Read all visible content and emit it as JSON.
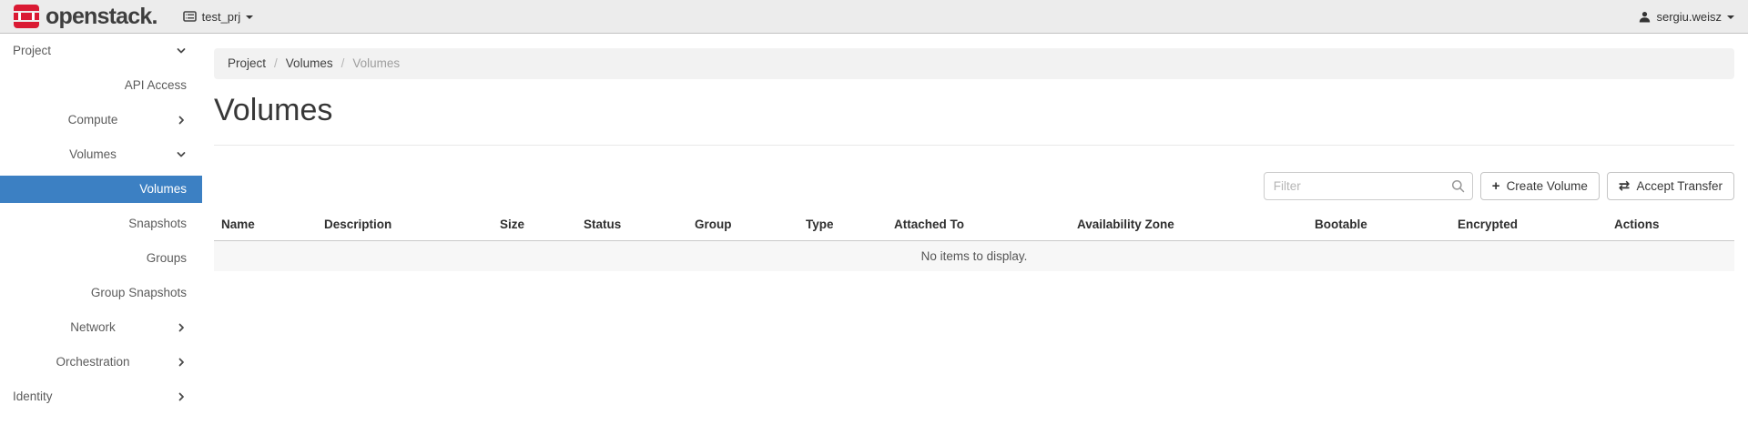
{
  "navbar": {
    "brand": "openstack.",
    "project_switcher": "test_prj",
    "user": "sergiu.weisz"
  },
  "sidebar": {
    "items": [
      {
        "label": "Project",
        "level": 1,
        "state": "expanded"
      },
      {
        "label": "API Access",
        "level": 3,
        "state": "link"
      },
      {
        "label": "Compute",
        "level": 2,
        "state": "collapsed"
      },
      {
        "label": "Volumes",
        "level": 2,
        "state": "expanded"
      },
      {
        "label": "Volumes",
        "level": 3,
        "state": "active"
      },
      {
        "label": "Snapshots",
        "level": 3,
        "state": "link"
      },
      {
        "label": "Groups",
        "level": 3,
        "state": "link"
      },
      {
        "label": "Group Snapshots",
        "level": 3,
        "state": "link"
      },
      {
        "label": "Network",
        "level": 2,
        "state": "collapsed"
      },
      {
        "label": "Orchestration",
        "level": 2,
        "state": "collapsed"
      },
      {
        "label": "Identity",
        "level": 1,
        "state": "collapsed"
      }
    ]
  },
  "breadcrumb": {
    "separator": "/",
    "items": [
      "Project",
      "Volumes",
      "Volumes"
    ]
  },
  "page": {
    "title": "Volumes"
  },
  "toolbar": {
    "filter_placeholder": "Filter",
    "create_volume_label": "Create Volume",
    "accept_transfer_label": "Accept Transfer"
  },
  "icons": {
    "plus": "+",
    "exchange": "⇄"
  },
  "table": {
    "columns": [
      "Name",
      "Description",
      "Size",
      "Status",
      "Group",
      "Type",
      "Attached To",
      "Availability Zone",
      "Bootable",
      "Encrypted",
      "Actions"
    ],
    "empty_message": "No items to display."
  },
  "colors": {
    "brand_red": "#da1a33",
    "active_item_blue": "#3c80c3",
    "navbar_bg": "#ececec",
    "breadcrumb_bg": "#f2f2f2",
    "empty_row_bg": "#f7f7f7"
  }
}
